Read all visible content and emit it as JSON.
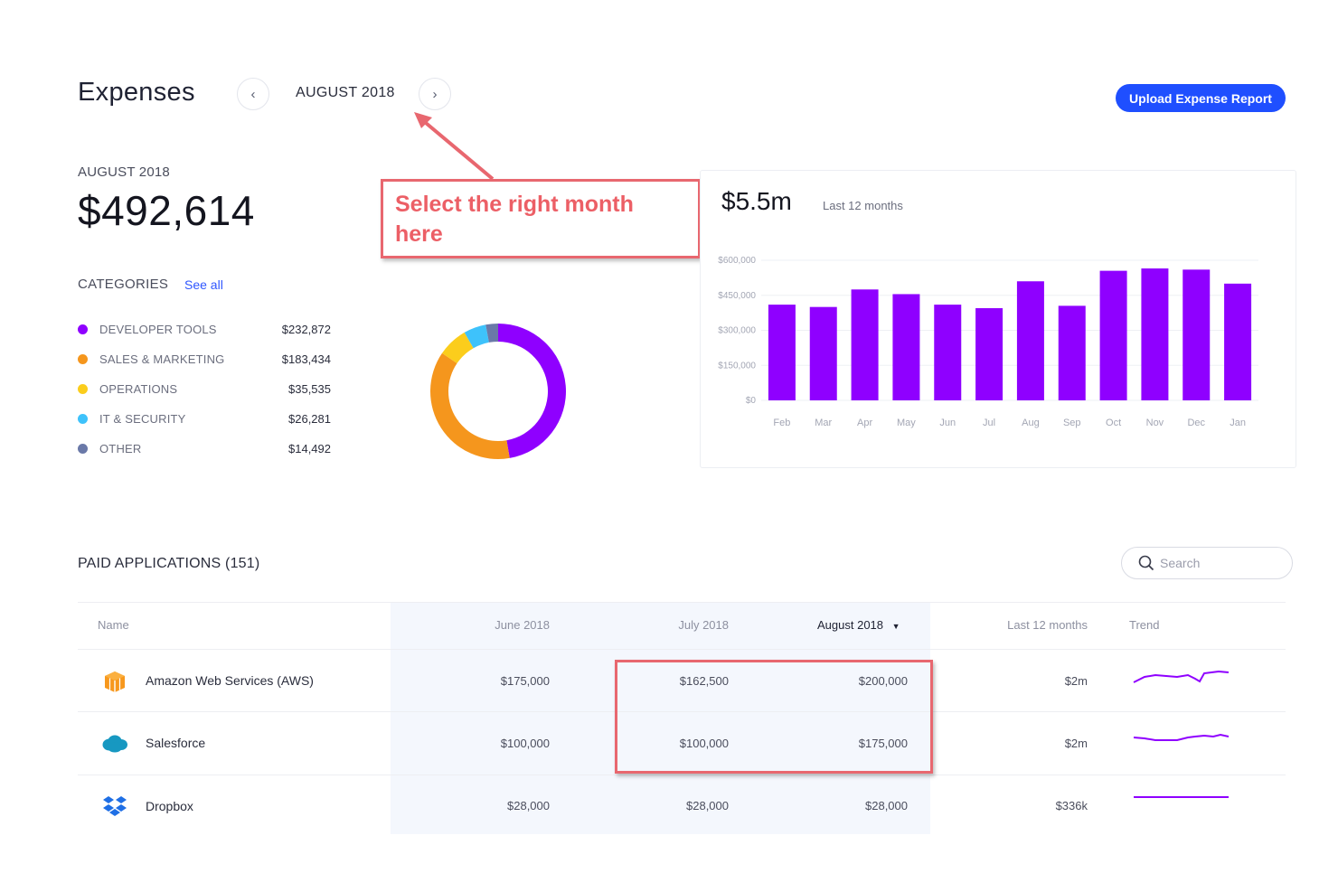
{
  "header": {
    "title": "Expenses",
    "prev_icon": "chevron-left-icon",
    "next_icon": "chevron-right-icon",
    "month": "AUGUST 2018",
    "upload_label": "Upload Expense Report"
  },
  "summary": {
    "month": "AUGUST 2018",
    "total_symbol": "$",
    "total_value": "492,614"
  },
  "categories": {
    "heading": "CATEGORIES",
    "see_all": "See all",
    "items": [
      {
        "name": "DEVELOPER TOOLS",
        "amount": "$232,872",
        "color": "#8f00ff"
      },
      {
        "name": "SALES & MARKETING",
        "amount": "$183,434",
        "color": "#f5961d"
      },
      {
        "name": "OPERATIONS",
        "amount": "$35,535",
        "color": "#fbcd1c"
      },
      {
        "name": "IT & SECURITY",
        "amount": "$26,281",
        "color": "#3ec2fb"
      },
      {
        "name": "OTHER",
        "amount": "$14,492",
        "color": "#6a79a8"
      }
    ]
  },
  "callout": {
    "text_line1": "Select the right month",
    "text_line2": "here"
  },
  "spending_chart": {
    "total": "$5.5m",
    "subtitle": "Last 12 months"
  },
  "chart_data": {
    "type": "bar",
    "categories": [
      "Feb",
      "Mar",
      "Apr",
      "May",
      "Jun",
      "Jul",
      "Aug",
      "Sep",
      "Oct",
      "Nov",
      "Dec",
      "Jan"
    ],
    "values": [
      410000,
      400000,
      475000,
      455000,
      410000,
      395000,
      510000,
      405000,
      555000,
      565000,
      560000,
      500000
    ],
    "ylim": [
      0,
      600000
    ],
    "yticks": [
      "$600,000",
      "$450,000",
      "$300,000",
      "$150,000",
      "$0"
    ],
    "bar_color": "#8f00ff",
    "grid": true
  },
  "apps": {
    "title": "PAID APPLICATIONS (151)",
    "search_placeholder": "Search",
    "columns": {
      "name": "Name",
      "june": "June 2018",
      "july": "July 2018",
      "august": "August 2018",
      "last12": "Last 12 months",
      "trend": "Trend"
    },
    "rows": [
      {
        "name": "Amazon Web Services (AWS)",
        "icon": "aws-icon",
        "june": "$175,000",
        "july": "$162,500",
        "august": "$200,000",
        "last12": "$2m"
      },
      {
        "name": "Salesforce",
        "icon": "salesforce-icon",
        "june": "$100,000",
        "july": "$100,000",
        "august": "$175,000",
        "last12": "$2m"
      },
      {
        "name": "Dropbox",
        "icon": "dropbox-icon",
        "june": "$28,000",
        "july": "$28,000",
        "august": "$28,000",
        "last12": "$336k"
      }
    ]
  },
  "colors": {
    "accent": "#1f4fff",
    "bar": "#8f00ff",
    "callout": "#e8676f"
  }
}
